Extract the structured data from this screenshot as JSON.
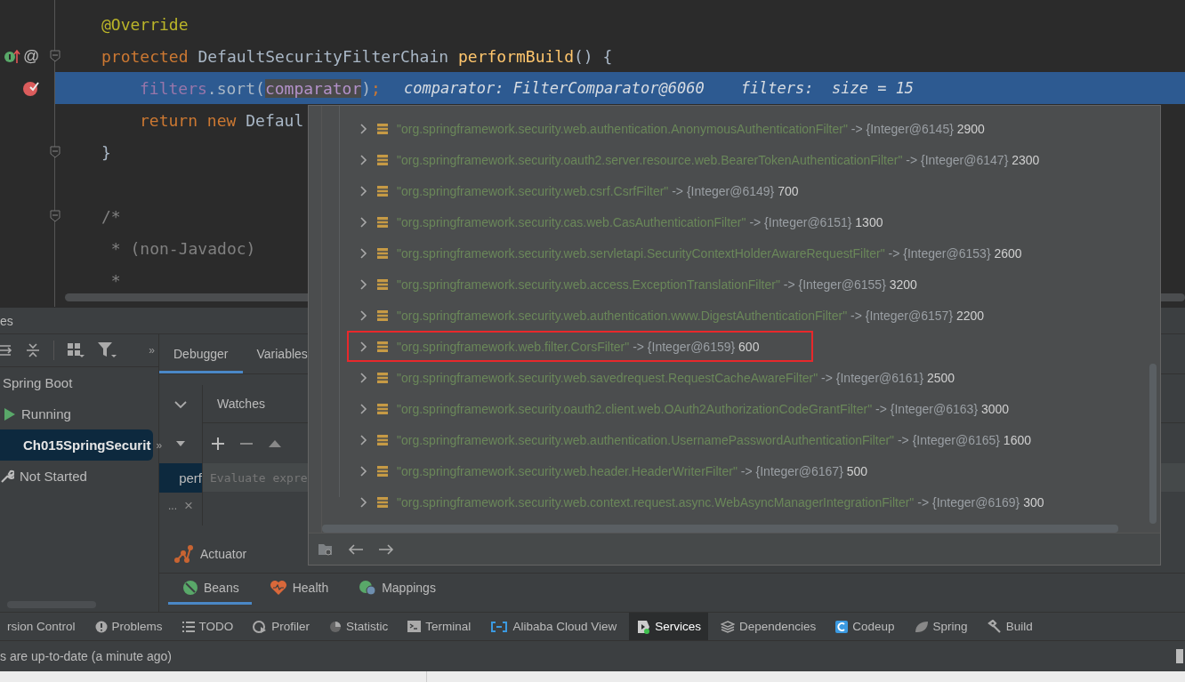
{
  "editor": {
    "lines": [
      {
        "tokens": [
          {
            "text": "@Override",
            "kind": "annotation"
          }
        ],
        "indented": false,
        "overrides": false,
        "breakpoint": false,
        "foldable": false,
        "current": false
      },
      {
        "tokens": [
          {
            "text": "protected ",
            "kind": "keyword"
          },
          {
            "text": "DefaultSecurityFilterChain ",
            "kind": "plain"
          },
          {
            "text": "performBuild",
            "kind": "method"
          },
          {
            "text": "() {",
            "kind": "plain"
          }
        ],
        "gutter_mark": "@",
        "indented": false,
        "overrides": true,
        "breakpoint": false,
        "foldable": true,
        "current": false
      },
      {
        "tokens": [
          {
            "text": "filters",
            "kind": "field"
          },
          {
            "text": ".sort(",
            "kind": "plain"
          },
          {
            "text": "comparator",
            "kind": "param"
          },
          {
            "text": ")",
            "kind": "plain"
          },
          {
            "text": ";",
            "kind": "keyword"
          }
        ],
        "indented": true,
        "overrides": false,
        "breakpoint": true,
        "foldable": false,
        "current": true,
        "hint": "comparator: FilterComparator@6060    filters:  size = 15"
      },
      {
        "tokens": [
          {
            "text": "return new ",
            "kind": "keyword"
          },
          {
            "text": "Defaul",
            "kind": "plain"
          }
        ],
        "indented": true,
        "overrides": false,
        "breakpoint": false,
        "foldable": false,
        "current": false
      },
      {
        "tokens": [
          {
            "text": "}",
            "kind": "plain"
          }
        ],
        "indented": false,
        "overrides": false,
        "breakpoint": false,
        "foldable": true,
        "current": false
      },
      {
        "overrides": false,
        "breakpoint": false,
        "foldable": false,
        "current": false
      },
      {
        "tokens": [
          {
            "text": "/*",
            "kind": "comment"
          }
        ],
        "indented": false,
        "overrides": false,
        "breakpoint": false,
        "foldable": true,
        "current": false
      },
      {
        "tokens": [
          {
            "text": " * (non-Javadoc)",
            "kind": "comment"
          }
        ],
        "indented": false,
        "overrides": false,
        "breakpoint": false,
        "foldable": false,
        "current": false
      },
      {
        "tokens": [
          {
            "text": " *",
            "kind": "comment"
          }
        ],
        "indented": false,
        "overrides": false,
        "breakpoint": false,
        "foldable": false,
        "current": false
      }
    ]
  },
  "popup": {
    "rows": [
      {
        "key": "\"org.springframework.security.web.authentication.AnonymousAuthenticationFilter\"",
        "ref": "-> {Integer@6145}",
        "value": "2900",
        "highlighted": false
      },
      {
        "key": "\"org.springframework.security.oauth2.server.resource.web.BearerTokenAuthenticationFilter\"",
        "ref": "-> {Integer@6147}",
        "value": "2300",
        "highlighted": false
      },
      {
        "key": "\"org.springframework.security.web.csrf.CsrfFilter\"",
        "ref": "-> {Integer@6149}",
        "value": "700",
        "highlighted": false
      },
      {
        "key": "\"org.springframework.security.cas.web.CasAuthenticationFilter\"",
        "ref": "-> {Integer@6151}",
        "value": "1300",
        "highlighted": false
      },
      {
        "key": "\"org.springframework.security.web.servletapi.SecurityContextHolderAwareRequestFilter\"",
        "ref": "-> {Integer@6153}",
        "value": "2600",
        "highlighted": false
      },
      {
        "key": "\"org.springframework.security.web.access.ExceptionTranslationFilter\"",
        "ref": "-> {Integer@6155}",
        "value": "3200",
        "highlighted": false
      },
      {
        "key": "\"org.springframework.security.web.authentication.www.DigestAuthenticationFilter\"",
        "ref": "-> {Integer@6157}",
        "value": "2200",
        "highlighted": false
      },
      {
        "key": "\"org.springframework.web.filter.CorsFilter\"",
        "ref": "-> {Integer@6159}",
        "value": "600",
        "highlighted": true
      },
      {
        "key": "\"org.springframework.security.web.savedrequest.RequestCacheAwareFilter\"",
        "ref": "-> {Integer@6161}",
        "value": "2500",
        "highlighted": false
      },
      {
        "key": "\"org.springframework.security.oauth2.client.web.OAuth2AuthorizationCodeGrantFilter\"",
        "ref": "-> {Integer@6163}",
        "value": "3000",
        "highlighted": false
      },
      {
        "key": "\"org.springframework.security.web.authentication.UsernamePasswordAuthenticationFilter\"",
        "ref": "-> {Integer@6165}",
        "value": "1600",
        "highlighted": false
      },
      {
        "key": "\"org.springframework.security.web.header.HeaderWriterFilter\"",
        "ref": "-> {Integer@6167}",
        "value": "500",
        "highlighted": false
      },
      {
        "key": "\"org.springframework.security.web.context.request.async.WebAsyncManagerIntegrationFilter\"",
        "ref": "-> {Integer@6169}",
        "value": "300",
        "highlighted": false
      }
    ]
  },
  "services": {
    "title": "es",
    "overflow": "»",
    "tree": [
      {
        "label": "Spring Boot",
        "kind": "group",
        "selected": false,
        "children": [
          {
            "label": "Running",
            "kind": "running",
            "selected": false,
            "children": [
              {
                "label": "Ch015SpringSecurit",
                "kind": "app",
                "selected": true,
                "overflow": "»"
              }
            ]
          },
          {
            "label": "Not Started",
            "kind": "stopped",
            "selected": false
          }
        ]
      }
    ]
  },
  "debugger": {
    "tabs": [
      {
        "label": "Debugger",
        "selected": true
      },
      {
        "label": "Variables",
        "selected": false
      }
    ],
    "watches": {
      "title": "Watches",
      "placeholder": "Evaluate expre"
    },
    "frame": "perf",
    "frames_more": "...",
    "close": "×",
    "actuator": "Actuator",
    "actuator_tabs": [
      {
        "label": "Beans",
        "kind": "beans",
        "selected": true
      },
      {
        "label": "Health",
        "kind": "health",
        "selected": false
      },
      {
        "label": "Mappings",
        "kind": "mappings",
        "selected": false
      }
    ]
  },
  "tool_windows": [
    {
      "label": "rsion Control",
      "kind": "none",
      "selected": false
    },
    {
      "label": "Problems",
      "kind": "problems",
      "selected": false
    },
    {
      "label": "TODO",
      "kind": "todo",
      "selected": false
    },
    {
      "label": "Profiler",
      "kind": "profiler",
      "selected": false
    },
    {
      "label": "Statistic",
      "kind": "statistic",
      "selected": false
    },
    {
      "label": "Terminal",
      "kind": "terminal",
      "selected": false
    },
    {
      "label": "Alibaba Cloud View",
      "kind": "cloud",
      "selected": false
    },
    {
      "label": "Services",
      "kind": "services",
      "selected": true
    },
    {
      "label": "Dependencies",
      "kind": "dependencies",
      "selected": false
    },
    {
      "label": "Codeup",
      "kind": "codeup",
      "selected": false
    },
    {
      "label": "Spring",
      "kind": "spring",
      "selected": false
    },
    {
      "label": "Build",
      "kind": "build",
      "selected": false
    }
  ],
  "status_bar": {
    "message": "s are up-to-date (a minute ago)"
  }
}
